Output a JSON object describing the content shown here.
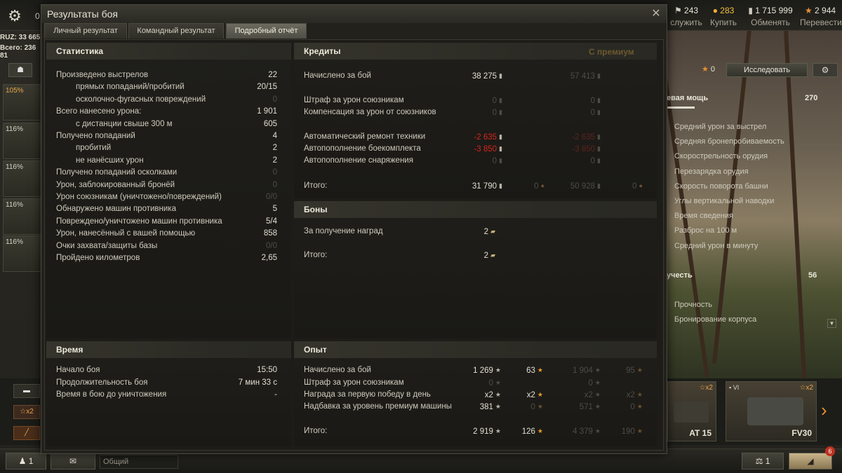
{
  "topbar": {
    "zero": "0",
    "resources": [
      {
        "value": "243",
        "label": "служить",
        "icon": "gold-star-icon"
      },
      {
        "value": "283",
        "label": "Купить",
        "icon": "gold-coin-icon"
      },
      {
        "value": "1 715 999",
        "label": "Обменять",
        "icon": "credits-icon"
      },
      {
        "value": "2 944",
        "label": "Перевести",
        "icon": "free-xp-star-icon"
      }
    ]
  },
  "left": {
    "ruz": "RUZ: 33 665",
    "total": "Всего: 236 81",
    "vehicles": [
      "105%",
      "116%",
      "116%",
      "116%",
      "116%"
    ]
  },
  "right": {
    "research_count": "0",
    "research_button": "Исследовать",
    "firepower_label": "евая мощь",
    "firepower_value": "270",
    "firepower_items": [
      "Средний урон за выстрел",
      "Средняя бронепробиваемость",
      "Скорострельность орудия",
      "Перезарядка орудия",
      "Скорость поворота башни",
      "Углы вертикальной наводки",
      "Время сведения",
      "Разброс на 100 м",
      "Средний урон в минуту"
    ],
    "survivability_label": "учесть",
    "survivability_value": "56",
    "survivability_items": [
      "Прочность",
      "Бронирование корпуса"
    ]
  },
  "carousel": {
    "tiles": [
      {
        "name": "AT 15",
        "tier": "☆x2"
      },
      {
        "name": "FV30",
        "tier": "☆x2",
        "level": "VI"
      }
    ],
    "left_badge": "☆x2"
  },
  "bottombar": {
    "players": "1",
    "chat_placeholder": "Общий",
    "balance": "1",
    "notifications": "6"
  },
  "dialog": {
    "title": "Результаты боя",
    "tabs": [
      "Личный результат",
      "Командный результат",
      "Подробный отчёт"
    ],
    "active_tab": 2,
    "stats": {
      "title": "Статистика",
      "rows": [
        {
          "label": "Произведено выстрелов",
          "value": "22",
          "indent": false,
          "dim": false
        },
        {
          "label": "прямых попаданий/пробитий",
          "value": "20/15",
          "indent": true,
          "dim": false
        },
        {
          "label": "осколочно-фугасных повреждений",
          "value": "0",
          "indent": true,
          "dim": true
        },
        {
          "label": "Всего нанесено урона:",
          "value": "1 901",
          "indent": false,
          "dim": false
        },
        {
          "label": "с дистанции свыше 300 м",
          "value": "605",
          "indent": true,
          "dim": false
        },
        {
          "label": "Получено попаданий",
          "value": "4",
          "indent": false,
          "dim": false
        },
        {
          "label": "пробитий",
          "value": "2",
          "indent": true,
          "dim": false
        },
        {
          "label": "не нанёсших урон",
          "value": "2",
          "indent": true,
          "dim": false
        },
        {
          "label": "Получено попаданий осколками",
          "value": "0",
          "indent": false,
          "dim": true
        },
        {
          "label": "Урон, заблокированный бронёй",
          "value": "0",
          "indent": false,
          "dim": true
        },
        {
          "label": "Урон союзникам (уничтожено/повреждений)",
          "value": "0/0",
          "indent": false,
          "dim": true
        },
        {
          "label": "Обнаружено машин противника",
          "value": "5",
          "indent": false,
          "dim": false
        },
        {
          "label": "Повреждено/уничтожено машин противника",
          "value": "5/4",
          "indent": false,
          "dim": false
        },
        {
          "label": "Урон, нанесённый с вашей помощью",
          "value": "858",
          "indent": false,
          "dim": false
        },
        {
          "label": "Очки захвата/защиты базы",
          "value": "0/0",
          "indent": false,
          "dim": true
        },
        {
          "label": "Пройдено километров",
          "value": "2,65",
          "indent": false,
          "dim": false
        }
      ]
    },
    "credits": {
      "title": "Кредиты",
      "premium_label": "С премиум",
      "rows": [
        {
          "label": "Начислено за бой",
          "base": "38 275",
          "base_style": "normal",
          "prem": "57 413",
          "prem_style": "dim"
        },
        {
          "label": "Штраф за урон союзникам",
          "base": "0",
          "base_style": "dim",
          "prem": "0",
          "prem_style": "dim"
        },
        {
          "label": "Компенсация за урон от союзников",
          "base": "0",
          "base_style": "dim",
          "prem": "0",
          "prem_style": "dim"
        },
        {
          "label": "Автоматический ремонт техники",
          "base": "-2 635",
          "base_style": "red",
          "prem": "-2 635",
          "prem_style": "reddim"
        },
        {
          "label": "Автопополнение боекомплекта",
          "base": "-3 850",
          "base_style": "red",
          "prem": "-3 850",
          "prem_style": "reddim"
        },
        {
          "label": "Автопополнение снаряжения",
          "base": "0",
          "base_style": "dim",
          "prem": "0",
          "prem_style": "dim"
        }
      ],
      "total_label": "Итого:",
      "total_base": "31 790",
      "total_base_gold": "0",
      "total_prem": "50 928",
      "total_prem_gold": "0"
    },
    "bonds": {
      "title": "Боны",
      "rows": [
        {
          "label": "За получение наград",
          "value": "2"
        }
      ],
      "total_label": "Итого:",
      "total_value": "2"
    },
    "time": {
      "title": "Время",
      "rows": [
        {
          "label": "Начало боя",
          "value": "15:50"
        },
        {
          "label": "Продолжительность боя",
          "value": "7 мин 33 с"
        },
        {
          "label": "Время в бою до уничтожения",
          "value": "-"
        }
      ]
    },
    "xp": {
      "title": "Опыт",
      "rows": [
        {
          "label": "Начислено за бой",
          "a": "1 269",
          "b": "63",
          "c": "1 904",
          "d": "95",
          "style": [
            "normal",
            "normal",
            "dim",
            "dim"
          ]
        },
        {
          "label": "Штраф за урон союзникам",
          "a": "0",
          "b": "",
          "c": "0",
          "d": "",
          "style": [
            "dim",
            "dim",
            "dim",
            "dim"
          ]
        },
        {
          "label": "Награда за первую победу в день",
          "a": "x2",
          "b": "x2",
          "c": "x2",
          "d": "x2",
          "style": [
            "normal",
            "normal",
            "dim",
            "dim"
          ]
        },
        {
          "label": "Надбавка за уровень премиум машины",
          "a": "381",
          "b": "0",
          "c": "571",
          "d": "0",
          "style": [
            "normal",
            "dim",
            "dim",
            "dim"
          ]
        }
      ],
      "total_label": "Итого:",
      "total": {
        "a": "2 919",
        "b": "126",
        "c": "4 379",
        "d": "190"
      }
    }
  }
}
